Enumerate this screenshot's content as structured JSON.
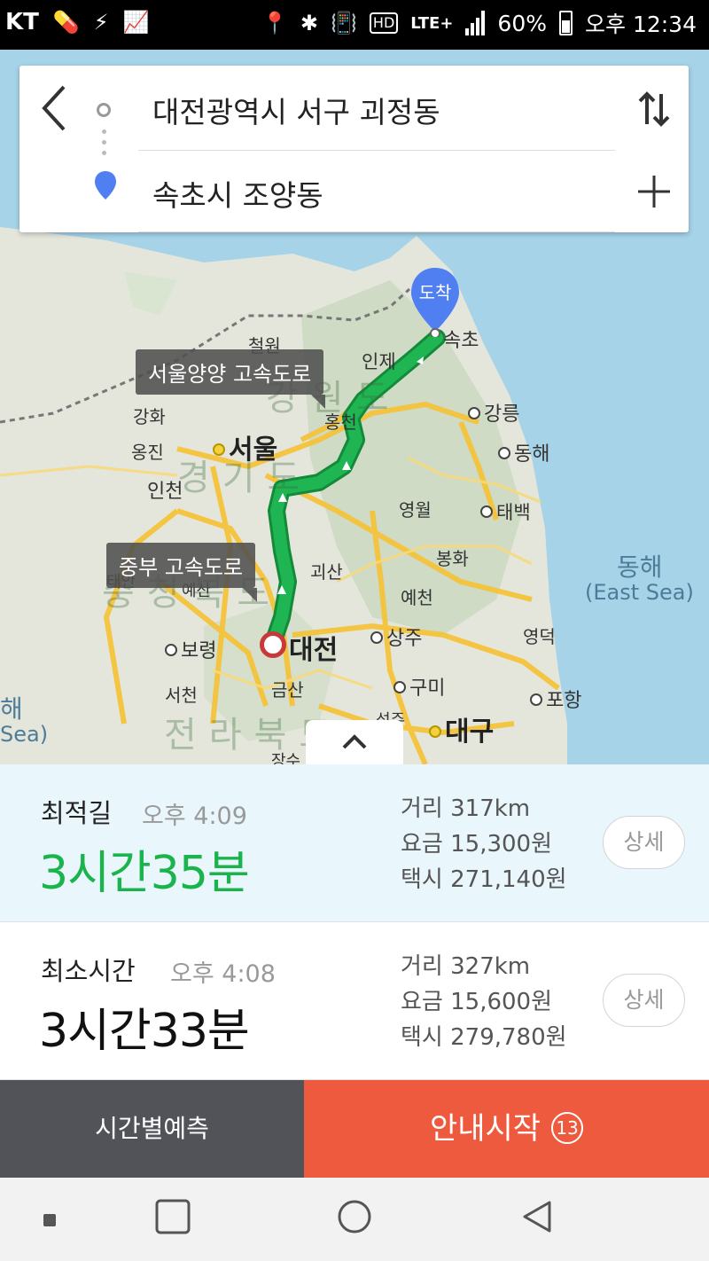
{
  "status_bar": {
    "carrier": "KT",
    "network": "LTE+",
    "battery": "60%",
    "time": "오후 12:34"
  },
  "search": {
    "origin": "대전광역시 서구 괴정동",
    "destination": "속초시 조양동"
  },
  "map": {
    "destination_pin_label": "도착",
    "road_labels": [
      "서울양양 고속도로",
      "중부 고속도로"
    ],
    "places": {
      "sokcho": "속초",
      "inje": "인제",
      "cheorwon": "철원",
      "hongcheon": "홍천",
      "gangneung": "강릉",
      "donghae_city": "동해",
      "ganghwa": "강화",
      "ongjin": "옹진",
      "seoul": "서울",
      "incheon": "인천",
      "yeongwol": "영월",
      "taebaek": "태백",
      "bonghwa": "봉화",
      "goesan": "괴산",
      "yecheon": "예천",
      "yesan": "예산",
      "taean": "태안",
      "boryeong": "보령",
      "daejeon": "대전",
      "sangju": "상주",
      "yeongdeok": "영덕",
      "seocheon": "서천",
      "geumsan": "금산",
      "gumi": "구미",
      "pohang": "포항",
      "daegu": "대구",
      "seongju": "성주",
      "jangsu": "장수",
      "east_sea_ko": "동해",
      "east_sea_en": "(East Sea)",
      "west_sea_en": "Sea)",
      "west_sea_ko": "해"
    },
    "provinces": {
      "gangwon": "강원도",
      "gyeonggi": "경기도",
      "chungbuk": "충청북도",
      "jeonbuk": "전라북도"
    }
  },
  "routes": [
    {
      "name": "최적길",
      "eta": "오후 4:09",
      "duration": "3시간35분",
      "distance": "거리 317km",
      "toll": "요금 15,300원",
      "taxi": "택시 271,140원",
      "detail_label": "상세",
      "selected": true
    },
    {
      "name": "최소시간",
      "eta": "오후 4:08",
      "duration": "3시간33분",
      "distance": "거리 327km",
      "toll": "요금 15,600원",
      "taxi": "택시 279,780원",
      "detail_label": "상세",
      "selected": false
    }
  ],
  "actions": {
    "predict_label": "시간별예측",
    "start_label": "안내시작",
    "countdown": "13"
  },
  "colors": {
    "route_green": "#1bb44c",
    "start_orange": "#ee5a3e",
    "predict_gray": "#525358",
    "pin_blue": "#4f7ff0",
    "origin_red": "#c83a3a"
  }
}
